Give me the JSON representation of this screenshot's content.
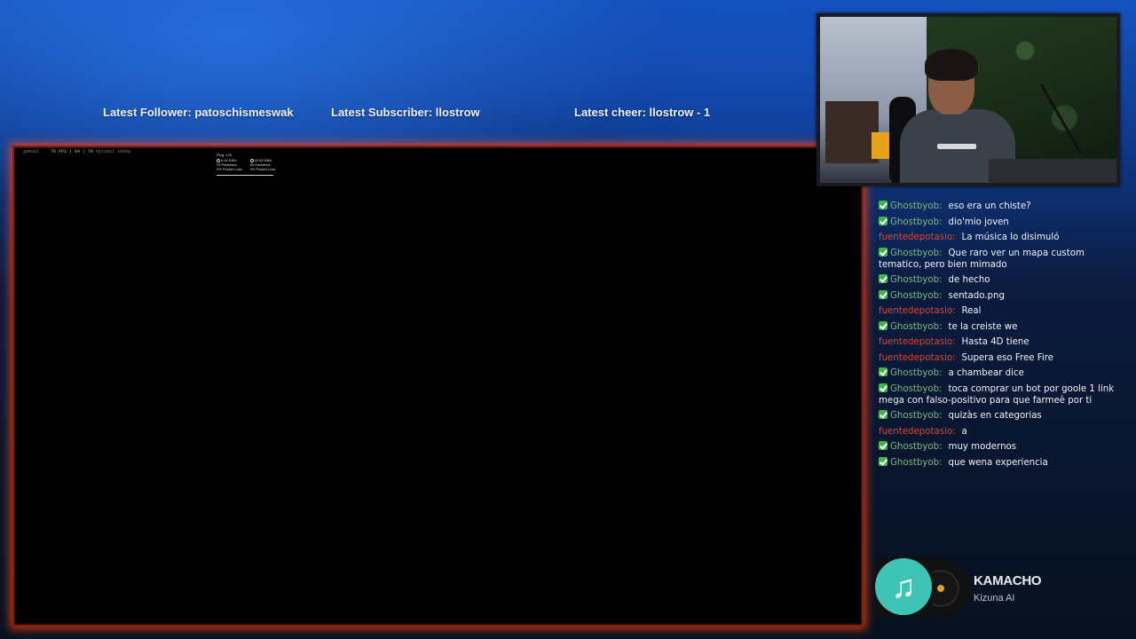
{
  "ticker": {
    "follower_label": "Latest Follower:",
    "follower_value": "patoschismeswak",
    "subscriber_label": "Latest Subscriber:",
    "subscriber_value": "llostrow",
    "cheer_label": "Latest cheer:",
    "cheer_value": "llostrow - 1"
  },
  "game_hud": {
    "left_text": "gameUI",
    "fps_text": "76 FPS | 64 | 76",
    "mode_text": "Optimal 1080p",
    "ping": "Ping: 176",
    "col1": [
      "0.64 KB/s",
      "29 Packets/s",
      "0% Packet Loss"
    ],
    "col2": [
      "10.60 KB/s",
      "50 Packets/s",
      "0% Packet Loss"
    ]
  },
  "chat": {
    "messages": [
      {
        "user": "Ghostbyob:",
        "text": "eso era un chiste?",
        "badge": true,
        "color": "green"
      },
      {
        "user": "Ghostbyob:",
        "text": "dio'mio joven",
        "badge": true,
        "color": "green"
      },
      {
        "user": "fuentedepotasio:",
        "text": "La música lo disimuló",
        "badge": false,
        "color": "red"
      },
      {
        "user": "Ghostbyob:",
        "text": "Que raro ver un mapa custom tematico, pero bien mimado",
        "badge": true,
        "color": "green"
      },
      {
        "user": "Ghostbyob:",
        "text": "de hecho",
        "badge": true,
        "color": "green"
      },
      {
        "user": "Ghostbyob:",
        "text": "sentado.png",
        "badge": true,
        "color": "green"
      },
      {
        "user": "fuentedepotasio:",
        "text": "Real",
        "badge": false,
        "color": "red"
      },
      {
        "user": "Ghostbyob:",
        "text": "te la creiste we",
        "badge": true,
        "color": "green"
      },
      {
        "user": "fuentedepotasio:",
        "text": "Hasta 4D tiene",
        "badge": false,
        "color": "red"
      },
      {
        "user": "fuentedepotasio:",
        "text": "Supera eso Free Fire",
        "badge": false,
        "color": "red"
      },
      {
        "user": "Ghostbyob:",
        "text": "a chambear dice",
        "badge": true,
        "color": "green"
      },
      {
        "user": "Ghostbyob:",
        "text": "toca comprar un bot por goole 1 link mega con falso-positivo para que farmeè por ti",
        "badge": true,
        "color": "green"
      },
      {
        "user": "Ghostbyob:",
        "text": "quizàs en categorias",
        "badge": true,
        "color": "green"
      },
      {
        "user": "fuentedepotasio:",
        "text": "a",
        "badge": false,
        "color": "red"
      },
      {
        "user": "Ghostbyob:",
        "text": "muy modernos",
        "badge": true,
        "color": "green"
      },
      {
        "user": "Ghostbyob:",
        "text": "que wena experiencia",
        "badge": true,
        "color": "green"
      }
    ]
  },
  "now_playing": {
    "icon": "music-note-icon",
    "song": "KAMACHO",
    "artist": "Kizuna AI"
  },
  "colors": {
    "chat_user_green": "#7fb686",
    "chat_user_red": "#e8412b",
    "game_border_glow": "#ff4614",
    "album_teal": "#3fc3b4"
  }
}
